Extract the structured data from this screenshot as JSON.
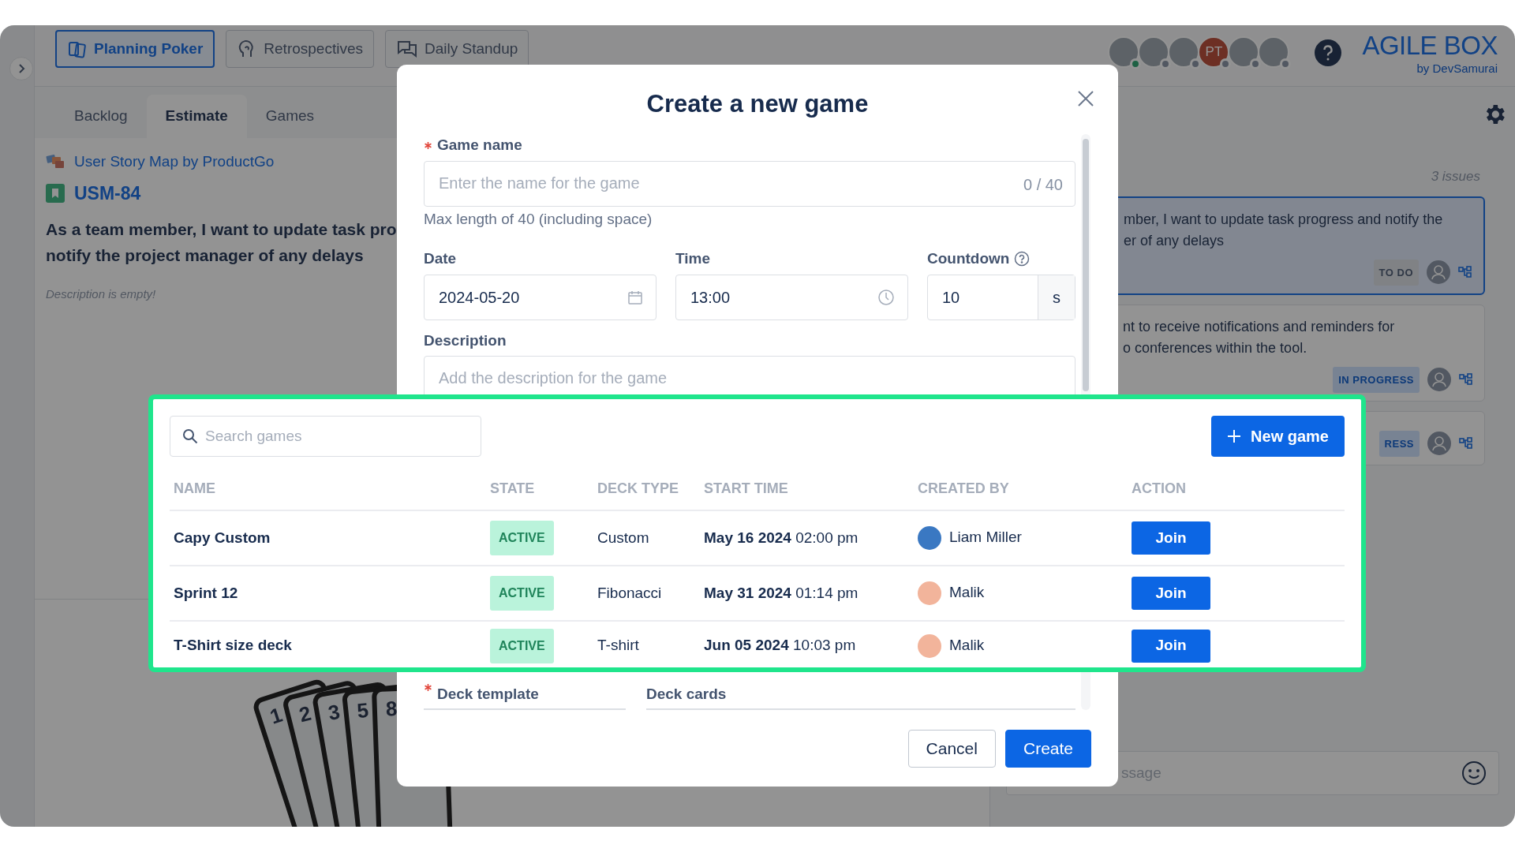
{
  "tool_tabs": [
    {
      "label": "Planning Poker",
      "kind": "cards",
      "selected": true
    },
    {
      "label": "Retrospectives",
      "kind": "head",
      "selected": false
    },
    {
      "label": "Daily Standup",
      "kind": "chat",
      "selected": false
    }
  ],
  "online_users": [
    {
      "kind": "photo",
      "online": true
    },
    {
      "kind": "photo",
      "online": false
    },
    {
      "kind": "photo",
      "online": false
    },
    {
      "kind": "initials",
      "initials": "PT",
      "online": false
    },
    {
      "kind": "photo",
      "online": false
    },
    {
      "kind": "photo",
      "online": false
    }
  ],
  "brand": {
    "name": "AGILE BOX",
    "byline": "by DevSamurai"
  },
  "view_tabs": [
    {
      "label": "Backlog",
      "selected": false
    },
    {
      "label": "Estimate",
      "selected": true
    },
    {
      "label": "Games",
      "selected": false
    }
  ],
  "story": {
    "project": "User Story Map by ProductGo",
    "key": "USM-84",
    "title_lines": [
      "As a team member, I want to update task pro",
      "notify the project manager of any delays"
    ],
    "description": "Description is empty!"
  },
  "deck_artwork": {
    "card_numbers": [
      "1",
      "2",
      "3",
      "5",
      "8"
    ]
  },
  "issues": {
    "count": "3 issues",
    "items": [
      {
        "text_lines": [
          "mber, I want to update task progress and notify the",
          "er of any delays"
        ],
        "status": "TO DO",
        "kind": "todo",
        "selected": true
      },
      {
        "text_lines": [
          "nt to receive notifications and reminders for",
          "o conferences within the tool."
        ],
        "status": "IN PROGRESS",
        "kind": "progress",
        "selected": false
      },
      {
        "status": "RESS",
        "kind": "progress",
        "selected": false
      }
    ]
  },
  "chat": {
    "placeholder": "ssage"
  },
  "modal": {
    "title": "Create a new game",
    "game_name": {
      "label": "Game name",
      "required": true,
      "placeholder": "Enter the name for the game",
      "counter": "0 / 40",
      "help": "Max length of 40 (including space)"
    },
    "date": {
      "label": "Date",
      "value": "2024-05-20"
    },
    "time": {
      "label": "Time",
      "value": "13:00"
    },
    "countdown": {
      "label": "Countdown",
      "value": "10",
      "unit": "s"
    },
    "description": {
      "label": "Description",
      "placeholder": "Add the description for the game"
    },
    "deck_template": {
      "label": "Deck template",
      "required": true
    },
    "deck_cards": {
      "label": "Deck cards"
    },
    "buttons": [
      {
        "label": "Cancel",
        "kind": "secondary"
      },
      {
        "label": "Create",
        "kind": "primary"
      }
    ]
  },
  "games_panel": {
    "search_placeholder": "Search games",
    "new_button": "New game",
    "columns": [
      "NAME",
      "STATE",
      "DECK TYPE",
      "START TIME",
      "CREATED BY",
      "ACTION"
    ],
    "rows": [
      {
        "name": "Capy Custom",
        "state": "ACTIVE",
        "deck_type": "Custom",
        "start_time": "**May 16 2024** 02:00 pm",
        "created_by": "Liam Miller",
        "color": "#3a78c2",
        "action": "Join"
      },
      {
        "name": "Sprint 12",
        "state": "ACTIVE",
        "deck_type": "Fibonacci",
        "start_time": "**May 31 2024** 01:14 pm",
        "created_by": "Malik",
        "color": "#f2b49b",
        "action": "Join"
      },
      {
        "name": "T-Shirt size deck",
        "state": "ACTIVE",
        "deck_type": "T-shirt",
        "start_time": "**Jun 05 2024** 10:03 pm",
        "created_by": "Malik",
        "color": "#f2b49b",
        "action": "Join"
      }
    ]
  }
}
